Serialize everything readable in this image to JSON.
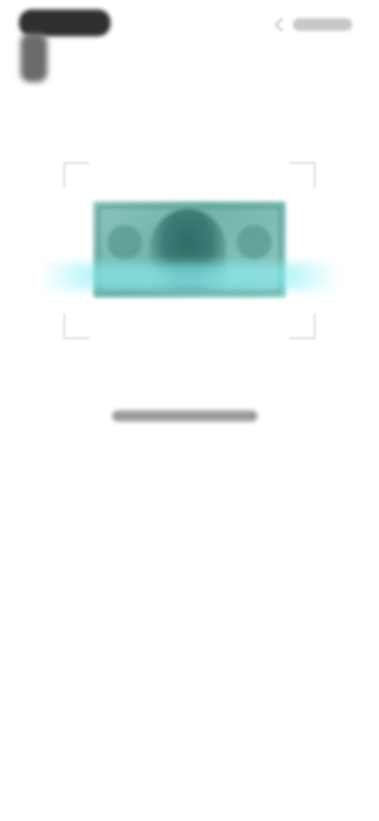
{
  "header": {
    "logo_icon": "app-logo-icon",
    "right_control_icon": "chevron-left-icon"
  },
  "scanner": {
    "frame_color": "#e6e6e6",
    "scan_line_color": "#8cf0f5",
    "note_image": "banknote-image"
  },
  "colors": {
    "background": "#ffffff",
    "note_green": "#6fb3ab",
    "logo_dark": "#2f2f2f"
  }
}
